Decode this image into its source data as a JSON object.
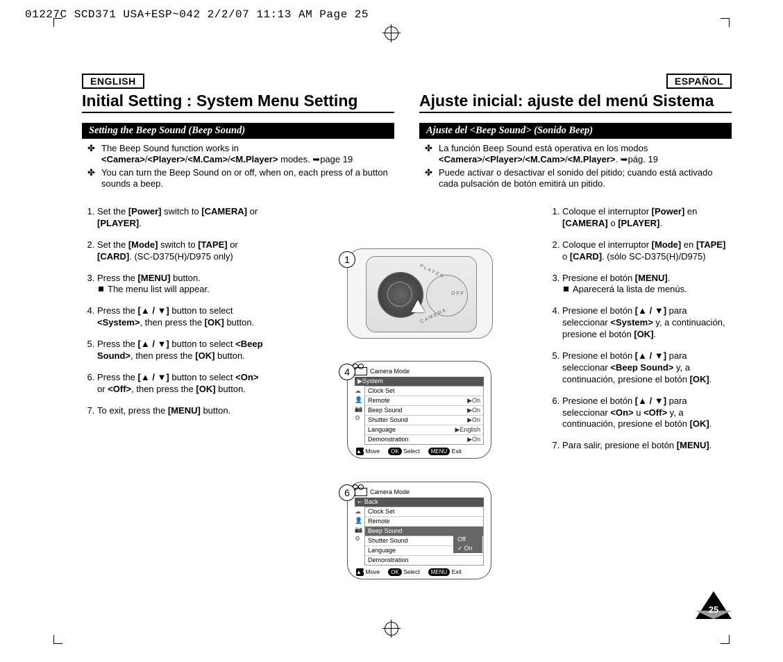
{
  "print_header": "01227C SCD371 USA+ESP~042  2/2/07 11:13 AM  Page 25",
  "page_number": "25",
  "en": {
    "lang": "ENGLISH",
    "title": "Initial Setting : System Menu Setting",
    "subhead": "Setting the Beep Sound (Beep Sound)",
    "bullets": [
      "The Beep Sound function works in <Camera>/<Player>/<M.Cam>/<M.Player> modes. ➥page 19",
      "You can turn the Beep Sound on or off, when on, each press of a button sounds a beep."
    ],
    "steps": [
      "Set the [Power] switch to [CAMERA] or [PLAYER].",
      "Set the [Mode] switch to [TAPE] or [CARD]. (SC-D375(H)/D975 only)",
      "Press the [MENU] button.\n■ The menu list will appear.",
      "Press the [▲ / ▼] button to select <System>, then press the [OK] button.",
      "Press the [▲ / ▼] button to select <Beep Sound>, then press the [OK] button.",
      "Press the [▲ / ▼] button to select <On> or <Off>, then press the [OK] button.",
      "To exit, press the [MENU] button."
    ]
  },
  "es": {
    "lang": "ESPAÑOL",
    "title": "Ajuste inicial: ajuste del menú Sistema",
    "subhead": "Ajuste del <Beep Sound> (Sonido Beep)",
    "bullets": [
      "La función Beep Sound está operativa en los modos <Camera>/<Player>/<M.Cam>/<M.Player>. ➥pág. 19",
      "Puede activar o desactivar el sonido del pitido; cuando está activado cada pulsación de botón emitirá un pitido."
    ],
    "steps": [
      "Coloque el interruptor [Power] en [CAMERA] o [PLAYER].",
      "Coloque el interruptor [Mode] en [TAPE] o [CARD]. (sólo SC-D375(H)/D975)",
      "Presione el botón [MENU].\n■ Aparecerá la lista de menús.",
      "Presione el botón [▲ / ▼] para seleccionar <System> y, a continuación, presione el botón [OK].",
      "Presione el botón [▲ / ▼] para seleccionar <Beep Sound> y, a continuación, presione el botón [OK].",
      "Presione el botón [▲ / ▼] para seleccionar <On> u <Off> y, a continuación, presione el botón [OK].",
      "Para salir, presione el botón [MENU]."
    ]
  },
  "fig1": {
    "circ": "1",
    "player": "PLAYER",
    "off": "OFF",
    "camera": "CAMERA"
  },
  "osd4": {
    "circ": "4",
    "mode": "Camera Mode",
    "top": "▶System",
    "rows": [
      {
        "l": "Clock Set",
        "v": ""
      },
      {
        "l": "Remote",
        "v": "▶On"
      },
      {
        "l": "Beep Sound",
        "v": "▶On"
      },
      {
        "l": "Shutter Sound",
        "v": "▶On"
      },
      {
        "l": "Language",
        "v": "▶English"
      },
      {
        "l": "Demonstration",
        "v": "▶On"
      }
    ],
    "foot": {
      "move": "Move",
      "ok": "OK",
      "select": "Select",
      "menu": "MENU",
      "exit": "Exit"
    }
  },
  "osd6": {
    "circ": "6",
    "mode": "Camera Mode",
    "top": "⭠ Back",
    "rows": [
      {
        "l": "Clock Set"
      },
      {
        "l": "Remote"
      },
      {
        "l": "Beep Sound",
        "sel": true
      },
      {
        "l": "Shutter Sound"
      },
      {
        "l": "Language"
      },
      {
        "l": "Demonstration"
      }
    ],
    "opts": [
      {
        "l": "Off"
      },
      {
        "l": "On",
        "ck": true
      }
    ],
    "foot": {
      "move": "Move",
      "ok": "OK",
      "select": "Select",
      "menu": "MENU",
      "exit": "Exit"
    }
  }
}
